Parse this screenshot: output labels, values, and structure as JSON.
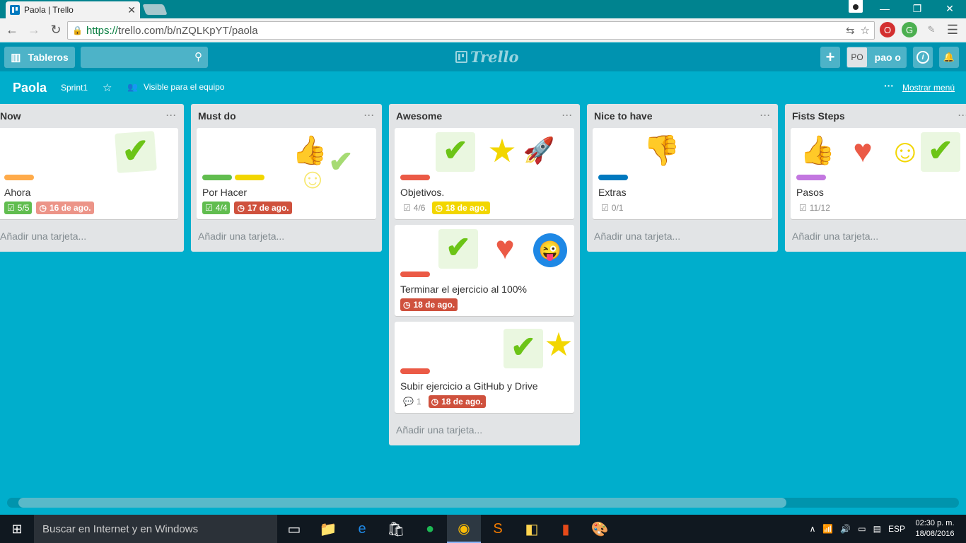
{
  "browser": {
    "tab_title": "Paola | Trello",
    "tab_close": "✕",
    "url_scheme": "https://",
    "url_rest": "trello.com/b/nZQLKpYT/paola",
    "window_controls": [
      "—",
      "❐",
      "✕"
    ]
  },
  "header": {
    "boards_label": "Tableros",
    "logo_text": "Trello",
    "add_label": "+",
    "avatar_initials": "PO",
    "user_name": "pao o",
    "info_label": "i",
    "bell_label": "🔔"
  },
  "board": {
    "title": "Paola",
    "sprint": "Sprint1",
    "visibility": "Visible para el equipo",
    "menu_dots": "···",
    "show_menu": "Mostrar menú"
  },
  "lists": [
    {
      "name": "Now",
      "add_card": "Añadir una tarjeta...",
      "cards": [
        {
          "title": "Ahora",
          "labels": [
            "#ffab4a"
          ],
          "checklist": "5/5",
          "due": "16 de ago.",
          "stickers": [
            "check"
          ]
        }
      ]
    },
    {
      "name": "Must do",
      "add_card": "Añadir una tarjeta...",
      "cards": [
        {
          "title": "Por Hacer",
          "labels": [
            "#61bd4f",
            "#f2d600"
          ],
          "checklist": "4/4",
          "due": "17 de ago.",
          "stickers": [
            "thumbs-up",
            "smile",
            "check"
          ]
        }
      ]
    },
    {
      "name": "Awesome",
      "add_card": "Añadir una tarjeta...",
      "cards": [
        {
          "title": "Objetivos.",
          "labels": [
            "#eb5a46"
          ],
          "checklist": "4/6",
          "due": "18 de ago.",
          "stickers": [
            "check",
            "star",
            "rocket"
          ]
        },
        {
          "title": "Terminar el ejercicio al 100%",
          "labels": [
            "#eb5a46"
          ],
          "due": "18 de ago.",
          "stickers": [
            "check",
            "heart",
            "wink"
          ]
        },
        {
          "title": "Subir ejercicio a GitHub y Drive",
          "labels": [
            "#eb5a46"
          ],
          "comments": "1",
          "due": "18 de ago.",
          "stickers": [
            "check",
            "star"
          ]
        }
      ]
    },
    {
      "name": "Nice to have",
      "add_card": "Añadir una tarjeta...",
      "cards": [
        {
          "title": "Extras",
          "labels": [
            "#0079bf"
          ],
          "checklist": "0/1",
          "stickers": [
            "thumbs-down"
          ]
        }
      ]
    },
    {
      "name": "Fists Steps",
      "add_card": "Añadir una tarjeta...",
      "cards": [
        {
          "title": "Pasos",
          "labels": [
            "#c377e0"
          ],
          "checklist": "11/12",
          "stickers": [
            "thumbs-up",
            "heart",
            "smile",
            "check"
          ]
        }
      ]
    }
  ],
  "taskbar": {
    "search_placeholder": "Buscar en Internet y en Windows",
    "lang": "ESP",
    "time": "02:30 p. m.",
    "date": "18/08/2016"
  }
}
